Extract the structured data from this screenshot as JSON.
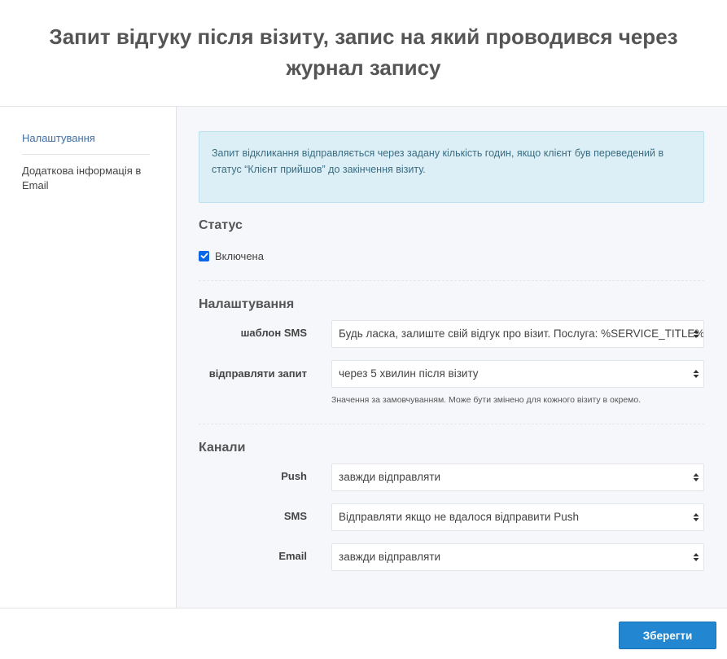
{
  "header": {
    "title": "Запит відгуку після візиту, запис на який проводився через журнал запису"
  },
  "sidebar": {
    "items": [
      {
        "label": "Налаштування"
      },
      {
        "label": "Додаткова інформація в Email"
      }
    ]
  },
  "info_box": {
    "text": "Запит відкликання відправляється через задану кількість годин, якщо клієнт був переведений в статус “Клієнт прийшов” до закінчення візиту."
  },
  "status": {
    "heading": "Статус",
    "checkbox_label": "Включена",
    "checked": true
  },
  "settings": {
    "heading": "Налаштування",
    "sms_template_label": "шаблон SMS",
    "sms_template_value": "Будь ласка, залиште свій відгук про візит. Послуга: %SERVICE_TITLE%",
    "send_request_label": "відправляти запит",
    "send_request_value": "через 5 хвилин після візиту",
    "send_request_hint": "Значення за замовчуванням. Може бути змінено для кожного візиту в окремо."
  },
  "channels": {
    "heading": "Канали",
    "push_label": "Push",
    "push_value": "завжди відправляти",
    "sms_label": "SMS",
    "sms_value": "Відправляти якщо не вдалося відправити Push",
    "email_label": "Email",
    "email_value": "завжди відправляти"
  },
  "footer": {
    "save_label": "Зберегти"
  },
  "colors": {
    "accent": "#2286d0",
    "info_bg": "#dceff6",
    "link": "#3d6fa7"
  }
}
